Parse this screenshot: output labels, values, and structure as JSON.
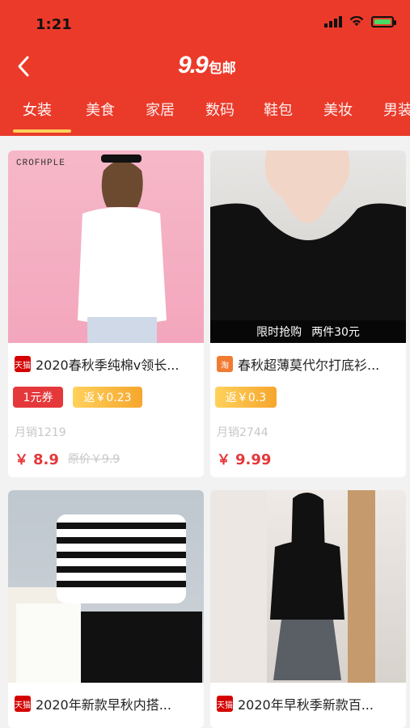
{
  "status": {
    "time": "1:21"
  },
  "header": {
    "logo_num": "9.9",
    "logo_text": "包邮",
    "tabs": [
      {
        "label": "女装"
      },
      {
        "label": "美食"
      },
      {
        "label": "家居"
      },
      {
        "label": "数码"
      },
      {
        "label": "鞋包"
      },
      {
        "label": "美妆"
      },
      {
        "label": "男装"
      }
    ]
  },
  "products": [
    {
      "brand": "CROFHPLE",
      "title": "2020春秋季纯棉v领长...",
      "coupon1": "1元券",
      "coupon2": "返￥0.23",
      "sales": "月销1219",
      "price_symbol": "￥",
      "price": "8.9",
      "original_price": "原价￥9.9",
      "badge": "天猫"
    },
    {
      "banner_left": "限时抢购",
      "banner_right": "两件30元",
      "title": "春秋超薄莫代尔打底衫...",
      "coupon2": "返￥0.3",
      "sales": "月销2744",
      "price_symbol": "￥",
      "price": "9.99",
      "badge": "淘"
    },
    {
      "title": "2020年新款早秋内搭...",
      "badge": "天猫"
    },
    {
      "title": "2020年早秋季新款百...",
      "badge": "天猫"
    }
  ],
  "colors": {
    "header_red": "#ec3a2a",
    "accent_yellow": "#ffd15b",
    "price_red": "#e5383b",
    "coupon_gold": "#f6a62d"
  }
}
